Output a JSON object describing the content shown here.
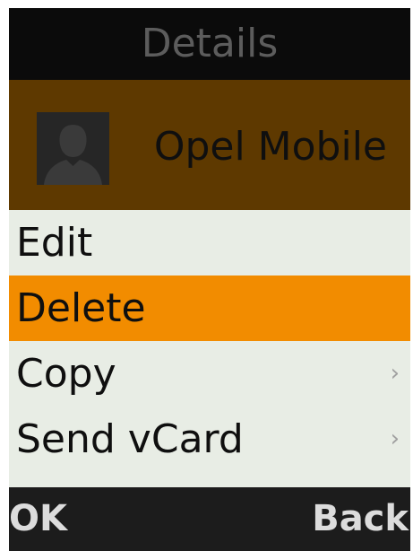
{
  "header": {
    "title": "Details"
  },
  "contact": {
    "name": "Opel Mobile",
    "avatar_icon": "person-silhouette-icon"
  },
  "menu": {
    "items": [
      {
        "label": "Edit",
        "selected": false,
        "has_submenu": false
      },
      {
        "label": "Delete",
        "selected": true,
        "has_submenu": false
      },
      {
        "label": "Copy",
        "selected": false,
        "has_submenu": true,
        "chevron": "›"
      },
      {
        "label": "Send vCard",
        "selected": false,
        "has_submenu": true,
        "chevron": "›"
      }
    ]
  },
  "softkeys": {
    "left": "OK",
    "right": "Back"
  },
  "colors": {
    "title_bar": "#0b0b0b",
    "contact_bar": "#5e3900",
    "menu_background": "#e8ede5",
    "selection_highlight": "#f28c00",
    "softkey_bar": "#1c1c1c"
  }
}
